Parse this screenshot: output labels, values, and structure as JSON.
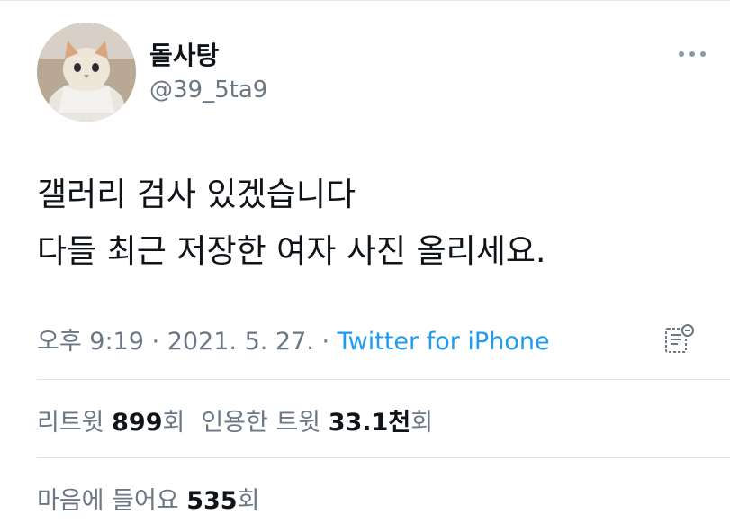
{
  "user": {
    "display_name": "돌사탕",
    "handle": "@39_5ta9"
  },
  "tweet": {
    "lines": [
      "갤러리 검사 있겠습니다",
      "다들 최근 저장한 여자 사진 올리세요."
    ]
  },
  "meta": {
    "time": "오후 9:19",
    "date": "2021. 5. 27.",
    "separator": "·",
    "source": "Twitter for iPhone"
  },
  "stats": {
    "retweets_label": "리트윗",
    "retweets_value": "899",
    "retweets_suffix": "회",
    "quotes_label": "인용한 트윗",
    "quotes_value": "33.1천",
    "quotes_suffix": "회",
    "likes_label": "마음에 들어요",
    "likes_value": "535",
    "likes_suffix": "회"
  },
  "icons": {
    "more": "more-horizontal-icon",
    "edit": "edit-history-icon"
  },
  "colors": {
    "link": "#1d9bf0",
    "secondary": "#6b7785",
    "text": "#0f1419"
  }
}
